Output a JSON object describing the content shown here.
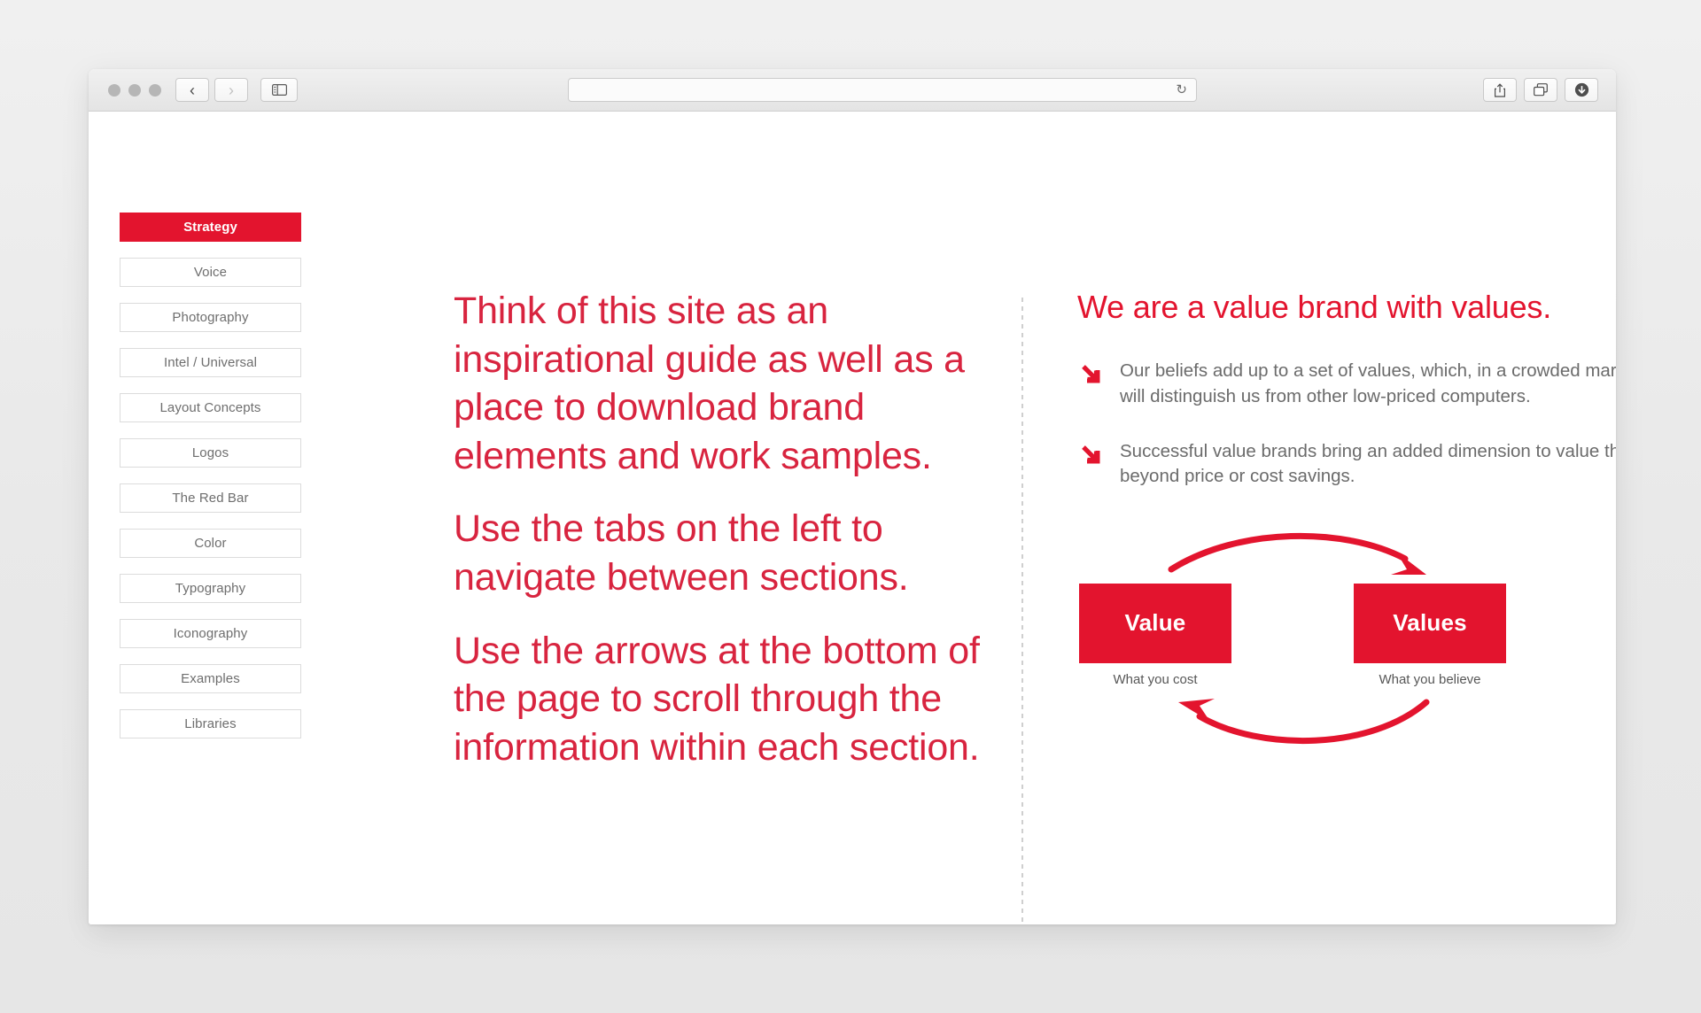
{
  "browser": {
    "traffic_lights": [
      "close",
      "minimize",
      "maximize"
    ],
    "back_label": "‹",
    "forward_label": "›",
    "sidebar_toggle": "sidebar",
    "address_value": "",
    "address_placeholder": "",
    "reload_label": "↻",
    "share_label": "share",
    "tabs_label": "tab-overview",
    "downloads_label": "downloads"
  },
  "sidebar": {
    "items": [
      {
        "label": "Strategy",
        "active": true
      },
      {
        "label": "Voice",
        "active": false
      },
      {
        "label": "Photography",
        "active": false
      },
      {
        "label": "Intel / Universal",
        "active": false
      },
      {
        "label": "Layout Concepts",
        "active": false
      },
      {
        "label": "Logos",
        "active": false
      },
      {
        "label": "The Red Bar",
        "active": false
      },
      {
        "label": "Color",
        "active": false
      },
      {
        "label": "Typography",
        "active": false
      },
      {
        "label": "Iconography",
        "active": false
      },
      {
        "label": "Examples",
        "active": false
      },
      {
        "label": "Libraries",
        "active": false
      }
    ]
  },
  "left_column": {
    "paragraphs": [
      "Think of this site as an inspirational guide as well as a place to download brand elements and work samples.",
      "Use the tabs on the left to navigate between sections.",
      "Use the arrows at the bottom  of the page to scroll through  the information within  each  section."
    ]
  },
  "right_column": {
    "heading": "We are a value brand with values.",
    "bullets": [
      "Our beliefs add up to a set of values, which, in a crowded marketplace, will distinguish us from other low-priced computers.",
      "Successful value brands bring an added dimension to value that goes beyond price or cost savings."
    ],
    "diagram": {
      "left_box_label": "Value",
      "left_caption": "What you cost",
      "right_box_label": "Values",
      "right_caption": "What you believe"
    }
  },
  "colors": {
    "brand_red": "#e3142e",
    "heading_red": "#d8243f",
    "body_gray": "#6b6b6b",
    "nav_text_gray": "#6e6e6e",
    "nav_border": "#dcdcdc",
    "divider": "#cfcfcf",
    "page_bg": "#ececec"
  }
}
